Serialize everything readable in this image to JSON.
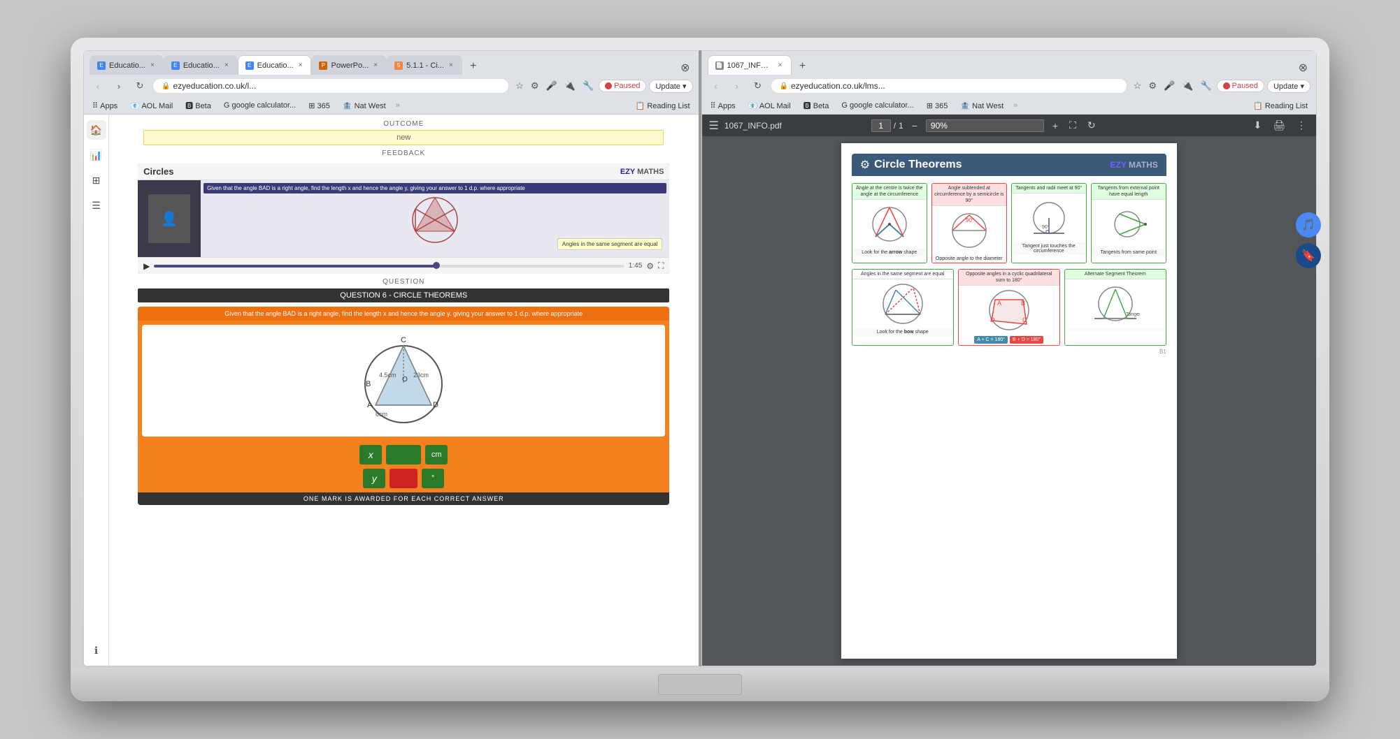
{
  "laptop": {
    "screen_title": "Laptop screen"
  },
  "left_browser": {
    "tabs": [
      {
        "label": "Educatio...",
        "favicon": "E",
        "active": false
      },
      {
        "label": "Educatio...",
        "favicon": "E",
        "active": false
      },
      {
        "label": "Educatio...",
        "favicon": "E",
        "active": true
      },
      {
        "label": "PowerPo...",
        "favicon": "P",
        "active": false
      },
      {
        "label": "5.1.1 - Ci...",
        "favicon": "5",
        "active": false
      }
    ],
    "url": "ezyeducation.co.uk/l...",
    "paused_label": "Paused",
    "update_label": "Update",
    "bookmarks": [
      "Apps",
      "AOL Mail",
      "Beta",
      "google calculator...",
      "365",
      "Nat West",
      "Reading List"
    ],
    "outcome_label": "OUTCOME",
    "outcome_value": "new",
    "feedback_label": "FEEDBACK",
    "video_title": "Circles",
    "video_ezy": "EZY",
    "video_ezy_maths": "MATHS",
    "video_caption": "Given that the angle BAD is a right angle, find the length x and hence the angle y, giving your answer to 1 d.p. where appropriate",
    "video_note": "Angles in the same segment are equal",
    "video_time": "1:45",
    "question_label": "QUESTION",
    "question_tag": "QUESTION 6 - CIRCLE THEOREMS",
    "question_desc": "Given that the angle BAD is a right angle, find the length x and hence the angle y. giving your answer to 1 d.p. where appropriate",
    "answer_x_var": "x",
    "answer_x_unit": "cm",
    "answer_y_var": "y",
    "answer_y_unit": "°",
    "one_mark": "ONE MARK IS AWARDED FOR EACH CORRECT ANSWER",
    "circle_labels": [
      "B",
      "C",
      "A",
      "O",
      "D"
    ],
    "circle_values": [
      "4.5cm",
      "23cm",
      "6cm"
    ]
  },
  "right_browser": {
    "url": "ezyeducation.co.uk/lms...",
    "paused_label": "Paused",
    "update_label": "Update",
    "pdf_filename": "1067_INFO.pdf",
    "pdf_page_current": "1",
    "pdf_page_total": "1",
    "pdf_zoom": "90%",
    "page_title": "Circle Theorems",
    "ezy_label": "EZY",
    "maths_label": "MATHS",
    "theorems": [
      {
        "label": "Angle at the centre is twice the angle at the circumference",
        "caption": "Look for the arrow shape",
        "border": "green"
      },
      {
        "label": "Angle subtended at circumference by a semicircle is 90°",
        "caption": "Opposite angle to the diameter",
        "border": "red"
      },
      {
        "label": "Tangents and radii meet at 90°",
        "caption": "Tangent just touches the circumference",
        "border": "green"
      },
      {
        "label": "Tangents from external point have equal length",
        "caption": "Tangents from same point",
        "border": "green"
      }
    ],
    "theorems_bottom": [
      {
        "label": "Angles in the same segment are equal",
        "caption": "Look for the bow shape",
        "border": "green"
      },
      {
        "label": "Opposite angles in a cyclic quadrilateral sum to 180°",
        "caption_a": "A + C = 180°",
        "caption_b": "B + D = 180°",
        "border": "red"
      },
      {
        "label": "Alternate Segment Theorem",
        "caption": "",
        "border": "green"
      }
    ],
    "page_number": "B1"
  }
}
